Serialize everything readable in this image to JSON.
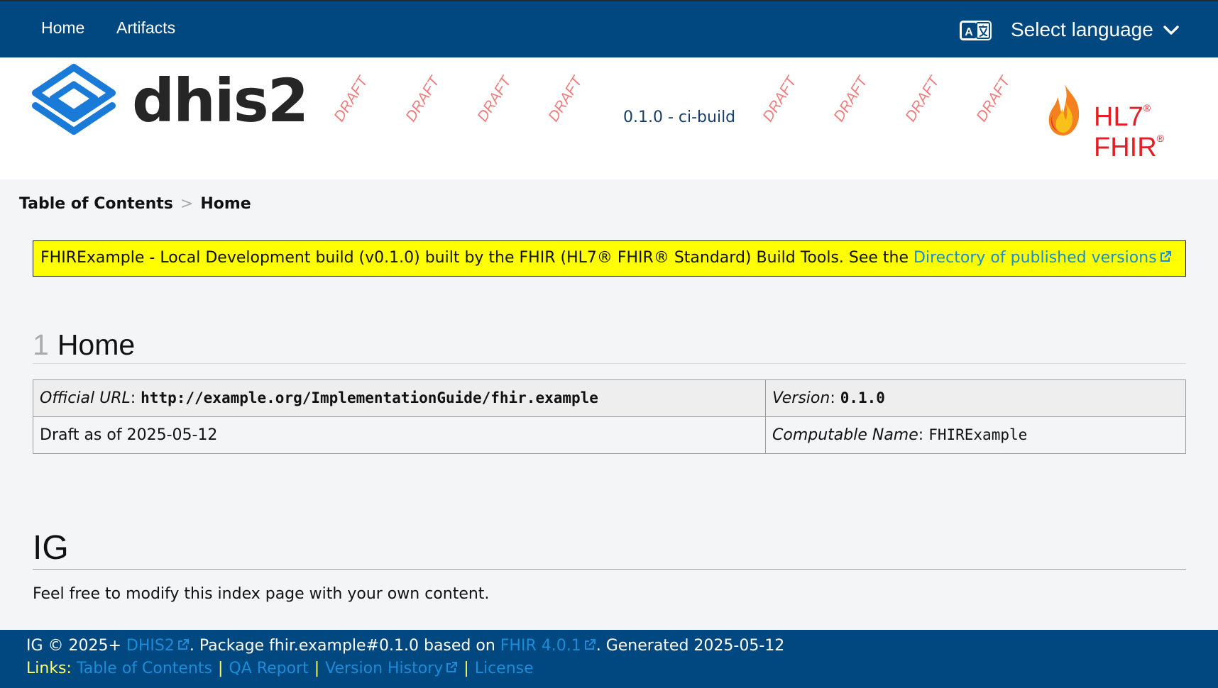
{
  "nav": {
    "home": "Home",
    "artifacts": "Artifacts",
    "select_language": "Select language"
  },
  "header": {
    "logo_text": "dhis2",
    "watermark": "DRAFT",
    "version_label": "0.1.0 - ci-build",
    "fhir_logo_text": "HL7",
    "fhir_logo_sup": "®",
    "fhir_logo_fhir": "FHIR",
    "fhir_logo_sup2": "®"
  },
  "breadcrumb": {
    "toc": "Table of Contents",
    "separator": ">",
    "current": "Home"
  },
  "notice": {
    "text": "FHIRExample - Local Development build (v0.1.0) built by the FHIR (HL7® FHIR® Standard) Build Tools. See the",
    "link": "Directory of published versions"
  },
  "page": {
    "section_number": "1",
    "title": "Home",
    "ig_heading": "IG",
    "paragraph": "Feel free to modify this index page with your own content."
  },
  "meta_table": {
    "official_url_label": "Official URL",
    "official_url": "http://example.org/ImplementationGuide/fhir.example",
    "version_label": "Version",
    "version": "0.1.0",
    "draft_text": "Draft as of 2025-05-12",
    "computable_name_label": "Computable Name",
    "computable_name": "FHIRExample"
  },
  "footer": {
    "ig_copyright": "IG © 2025+",
    "publisher_link": "DHIS2",
    "package_text": ". Package fhir.example#0.1.0 based on",
    "fhir_link": "FHIR 4.0.1",
    "generated_text": ". Generated 2025-05-12",
    "links_label": "Links:",
    "links": [
      "Table of Contents",
      "QA Report",
      "Version History",
      "License"
    ],
    "link_separator": "|"
  },
  "colors": {
    "nav_bg": "#00487f",
    "notice_bg": "#ffff00",
    "link": "#1a8cd8",
    "draft_watermark": "#ee7c7c",
    "fhir_red": "#e31e24",
    "dhis_blue": "#1a7ad8"
  }
}
